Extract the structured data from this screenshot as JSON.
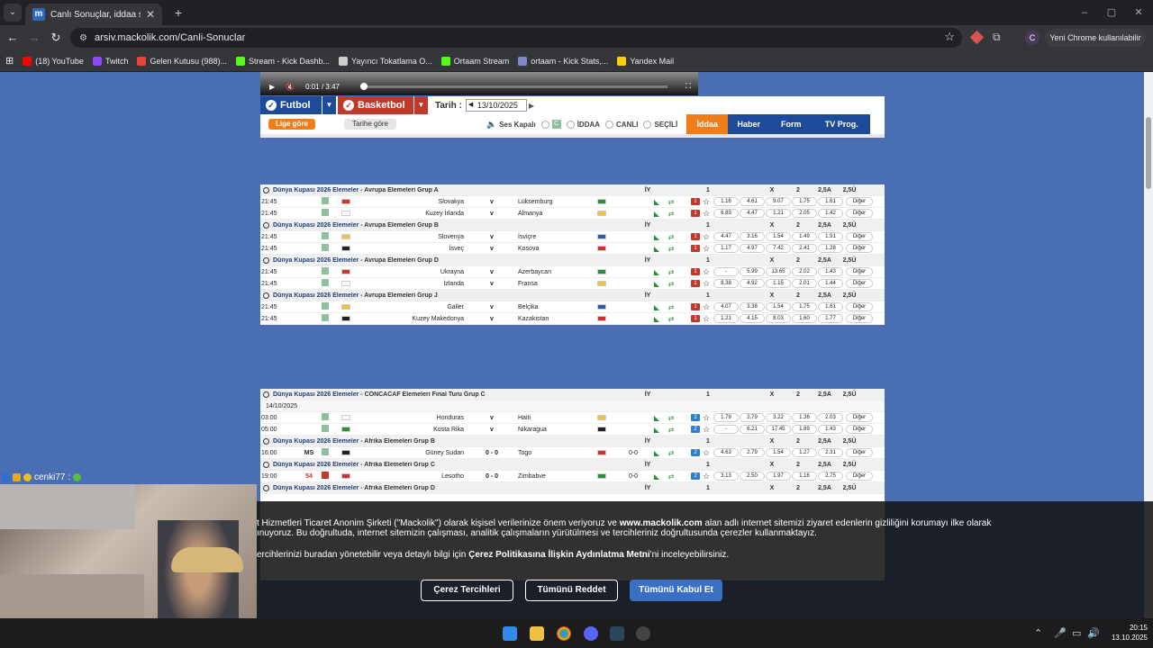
{
  "browser": {
    "tab_title": "Canlı Sonuçlar, iddaa sonuçları",
    "tab_favicon": "m",
    "url": "arsiv.mackolik.com/Canli-Sonuclar",
    "profile_initial": "C",
    "update_label": "Yeni Chrome kullanılabilir"
  },
  "bookmarks": [
    {
      "label": "(18) YouTube",
      "color": "#ff0000"
    },
    {
      "label": "Twitch",
      "color": "#9146ff"
    },
    {
      "label": "Gelen Kutusu (988)...",
      "color": "#ea4335"
    },
    {
      "label": "Stream - Kick Dashb...",
      "color": "#53fc18"
    },
    {
      "label": "Yayıncı Tokatlama O...",
      "color": "#cccccc"
    },
    {
      "label": "Ortaam Stream",
      "color": "#53fc18"
    },
    {
      "label": "ortaam - Kick Stats,...",
      "color": "#7a88cc"
    },
    {
      "label": "Yandex Mail",
      "color": "#ffcc00"
    }
  ],
  "video": {
    "current": "0:01",
    "separator": "/",
    "duration": "3:47",
    "progress": 0.004
  },
  "sports": {
    "football": "Futbol",
    "basketball": "Basketbol",
    "date_label": "Tarih :",
    "date_value": "13/10/2025"
  },
  "filters": {
    "by_league": "Lige göre",
    "by_date": "Tarihe göre",
    "sound": "Ses Kapalı",
    "iddaa": "İDDAA",
    "live": "CANLI",
    "selected": "SEÇİLİ",
    "tabs": [
      "İddaa",
      "Haber",
      "Form",
      "TV Prog."
    ]
  },
  "colors": {
    "accent_blue": "#1e4b99",
    "accent_red": "#c0392b",
    "orange": "#f07d1a",
    "page_bg": "#4a6eb3"
  },
  "table1": [
    {
      "type": "group",
      "league": "Dünya Kupası 2026 Elemeler",
      "sub": "Avrupa Elemeleri Grup A",
      "ht": "İY",
      "c1": "1",
      "cx": "X",
      "c2": "2",
      "u": "2,5A",
      "o": "2,5Ü"
    },
    {
      "type": "match",
      "time": "21:45",
      "home": "Slovakya",
      "away": "Lüksemburg",
      "score": "v",
      "o1": "1.16",
      "ox": "4.61",
      "o2": "9.07",
      "oa": "1.75",
      "ou": "1.61",
      "more": "Diğer",
      "mbs": "1"
    },
    {
      "type": "match",
      "time": "21:45",
      "home": "Kuzey İrlanda",
      "away": "Almanya",
      "score": "v",
      "o1": "6.83",
      "ox": "4.47",
      "o2": "1.21",
      "oa": "2.05",
      "ou": "1.42",
      "more": "Diğer",
      "mbs": "1"
    },
    {
      "type": "group",
      "league": "Dünya Kupası 2026 Elemeler",
      "sub": "Avrupa Elemeleri Grup B",
      "ht": "İY",
      "c1": "1",
      "cx": "X",
      "c2": "2",
      "u": "2,5A",
      "o": "2,5Ü"
    },
    {
      "type": "match",
      "time": "21:45",
      "home": "Slovenya",
      "away": "İsviçre",
      "score": "v",
      "o1": "4.47",
      "ox": "3.16",
      "o2": "1.54",
      "oa": "1.49",
      "ou": "1.91",
      "more": "Diğer",
      "mbs": "1"
    },
    {
      "type": "match",
      "time": "21:45",
      "home": "İsveç",
      "away": "Kosova",
      "score": "v",
      "o1": "1.17",
      "ox": "4.97",
      "o2": "7.42",
      "oa": "2.41",
      "ou": "1.28",
      "more": "Diğer",
      "mbs": "1"
    },
    {
      "type": "group",
      "league": "Dünya Kupası 2026 Elemeler",
      "sub": "Avrupa Elemeleri Grup D",
      "ht": "İY",
      "c1": "1",
      "cx": "X",
      "c2": "2",
      "u": "2,5A",
      "o": "2,5Ü"
    },
    {
      "type": "match",
      "time": "21:45",
      "home": "Ukrayna",
      "away": "Azerbaycan",
      "score": "v",
      "o1": "-",
      "ox": "5.99",
      "o2": "13.65",
      "oa": "2.02",
      "ou": "1.43",
      "more": "Diğer",
      "mbs": "1"
    },
    {
      "type": "match",
      "time": "21:45",
      "home": "İzlanda",
      "away": "Fransa",
      "score": "v",
      "o1": "8.38",
      "ox": "4.92",
      "o2": "1.15",
      "oa": "2.01",
      "ou": "1.44",
      "more": "Diğer",
      "mbs": "1"
    },
    {
      "type": "group",
      "league": "Dünya Kupası 2026 Elemeler",
      "sub": "Avrupa Elemeleri Grup J",
      "ht": "İY",
      "c1": "1",
      "cx": "X",
      "c2": "2",
      "u": "2,5A",
      "o": "2,5Ü"
    },
    {
      "type": "match",
      "time": "21:45",
      "home": "Galler",
      "away": "Belçika",
      "score": "v",
      "o1": "4.07",
      "ox": "3.38",
      "o2": "1.54",
      "oa": "1.75",
      "ou": "1.61",
      "more": "Diğer",
      "mbs": "1"
    },
    {
      "type": "match",
      "time": "21:45",
      "home": "Kuzey Makedonya",
      "away": "Kazakistan",
      "score": "v",
      "o1": "1.21",
      "ox": "4.15",
      "o2": "8.03",
      "oa": "1.60",
      "ou": "1.77",
      "more": "Diğer",
      "mbs": "1"
    }
  ],
  "table2": [
    {
      "type": "group",
      "league": "Dünya Kupası 2026 Elemeler",
      "sub": "CONCACAF Elemeleri Final Turu Grup C",
      "ht": "İY",
      "c1": "1",
      "cx": "X",
      "c2": "2",
      "u": "2,5A",
      "o": "2,5Ü"
    },
    {
      "type": "date",
      "date": "14/10/2025"
    },
    {
      "type": "match",
      "time": "03:00",
      "home": "Honduras",
      "away": "Haiti",
      "score": "v",
      "o1": "1.79",
      "ox": "2.79",
      "o2": "3.22",
      "oa": "1.36",
      "ou": "2.03",
      "more": "Diğer",
      "mbs": "2"
    },
    {
      "type": "match",
      "time": "05:00",
      "home": "Kosta Rika",
      "away": "Nikaragua",
      "score": "v",
      "o1": "-",
      "ox": "6.21",
      "o2": "17.45",
      "oa": "1.89",
      "ou": "1.43",
      "more": "Diğer",
      "mbs": "2"
    },
    {
      "type": "group",
      "league": "Dünya Kupası 2026 Elemeler",
      "sub": "Afrika Elemeleri Grup B",
      "ht": "İY",
      "c1": "1",
      "cx": "X",
      "c2": "2",
      "u": "2,5A",
      "o": "2,5Ü"
    },
    {
      "type": "match",
      "time": "16:00",
      "min": "MS",
      "home": "Güney Sudan",
      "away": "Togo",
      "score": "0 - 0",
      "ht_score": "0-0",
      "o1": "4.63",
      "ox": "2.79",
      "o2": "1.54",
      "oa": "1.27",
      "ou": "2.31",
      "more": "Diğer",
      "mbs": "2"
    },
    {
      "type": "group",
      "league": "Dünya Kupası 2026 Elemeler",
      "sub": "Afrika Elemeleri Grup C",
      "ht": "İY",
      "c1": "1",
      "cx": "X",
      "c2": "2",
      "u": "2,5A",
      "o": "2,5Ü"
    },
    {
      "type": "match",
      "time": "19:00",
      "min": "54",
      "home": "Lesotho",
      "away": "Zimbabve",
      "score": "0 - 0",
      "ht_score": "0-0",
      "o1": "3.13",
      "ox": "2.50",
      "o2": "1.97",
      "oa": "1.16",
      "ou": "2.75",
      "more": "Diğer",
      "mbs": "2",
      "live": true
    },
    {
      "type": "group",
      "league": "Dünya Kupası 2026 Elemeler",
      "sub": "Afrika Elemeleri Grup D",
      "ht": "İY",
      "c1": "1",
      "cx": "X",
      "c2": "2",
      "u": "2,5A",
      "o": "2,5Ü"
    }
  ],
  "chat": {
    "user": "cenki77",
    "sep": ":"
  },
  "cookie": {
    "line1_a": "t Hizmetleri Ticaret Anonim Şirketi (\"Mackolik\") olarak kişisel verilerinize önem veriyoruz ve ",
    "line1_site": "www.mackolik.com",
    "line1_b": " alan adlı internet sitemizi ziyaret edenlerin gizliliğini korumayı ilke olarak",
    "line2": "ınuyoruz. Bu doğrultuda, internet sitemizin çalışması, analitik çalışmaların yürütülmesi ve tercihleriniz doğrultusunda çerezler kullanmaktayız.",
    "line3_a": "ercihlerinizi buradan yönetebilir veya detaylı bilgi için ",
    "line3_link": "Çerez Politikasına İlişkin Aydınlatma Metni",
    "line3_b": "'ni inceleyebilirsiniz.",
    "btn_prefs": "Çerez Tercihleri",
    "btn_reject": "Tümünü Reddet",
    "btn_accept": "Tümünü Kabul Et"
  },
  "taskbar": {
    "time": "20:15",
    "date": "13.10.2025"
  }
}
